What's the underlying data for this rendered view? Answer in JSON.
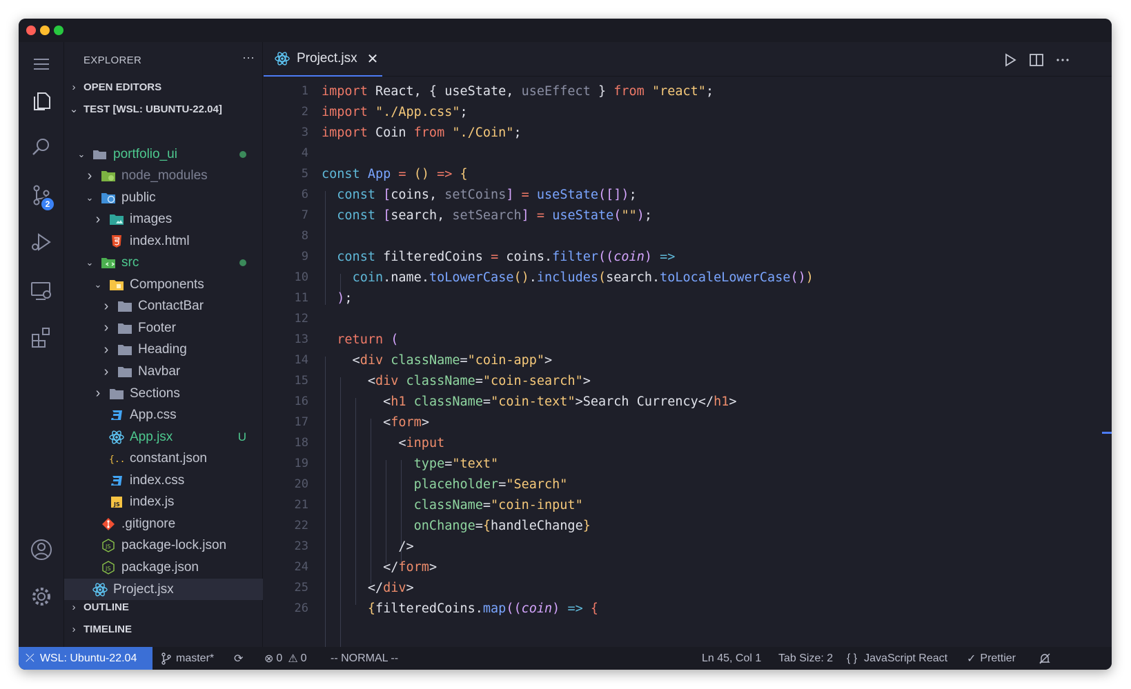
{
  "sidebar": {
    "title": "EXPLORER",
    "more": "···",
    "open_editors": "OPEN EDITORS",
    "workspace": "TEST [WSL: UBUNTU-22.04]",
    "outline": "OUTLINE",
    "timeline": "TIMELINE",
    "tree": [
      {
        "label": "portfolio_ui",
        "icon": "folder-open-icon",
        "dot": true,
        "color": "#4ec98f"
      },
      {
        "label": "node_modules",
        "icon": "node-folder-icon",
        "color": "#7c8093"
      },
      {
        "label": "public",
        "icon": "public-folder-icon"
      },
      {
        "label": "images",
        "icon": "images-folder-icon"
      },
      {
        "label": "index.html",
        "icon": "html-icon"
      },
      {
        "label": "src",
        "icon": "src-folder-icon",
        "dot": true,
        "color": "#4ec98f"
      },
      {
        "label": "Components",
        "icon": "components-folder-icon"
      },
      {
        "label": "ContactBar",
        "icon": "folder-icon"
      },
      {
        "label": "Footer",
        "icon": "folder-icon"
      },
      {
        "label": "Heading",
        "icon": "folder-icon"
      },
      {
        "label": "Navbar",
        "icon": "folder-icon"
      },
      {
        "label": "Sections",
        "icon": "folder-icon"
      },
      {
        "label": "App.css",
        "icon": "css-icon"
      },
      {
        "label": "App.jsx",
        "icon": "react-icon",
        "badge": "U",
        "color": "#4ec98f"
      },
      {
        "label": "constant.json",
        "icon": "json-icon"
      },
      {
        "label": "index.css",
        "icon": "css-icon"
      },
      {
        "label": "index.js",
        "icon": "js-icon"
      },
      {
        "label": ".gitignore",
        "icon": "git-icon"
      },
      {
        "label": "package-lock.json",
        "icon": "npm-icon"
      },
      {
        "label": "package.json",
        "icon": "npm-icon"
      },
      {
        "label": "Project.jsx",
        "icon": "react-icon",
        "active": true
      }
    ]
  },
  "activity": {
    "source_control_badge": "2"
  },
  "tab": {
    "label": "Project.jsx",
    "close": "✕"
  },
  "editor": {
    "line_numbers": [
      "1",
      "2",
      "3",
      "4",
      "5",
      "6",
      "7",
      "8",
      "9",
      "10",
      "11",
      "12",
      "13",
      "14",
      "15",
      "16",
      "17",
      "18",
      "19",
      "20",
      "21",
      "22",
      "23",
      "24",
      "25",
      "26"
    ]
  },
  "status": {
    "remote": "WSL: Ubuntu-22.04",
    "branch": "master*",
    "errors": "0",
    "warnings": "0",
    "mode": "-- NORMAL --",
    "position": "Ln 45, Col 1",
    "tab_size": "Tab Size: 2",
    "language": "JavaScript React",
    "formatter": "Prettier"
  },
  "colors": {
    "accent": "#3b6fd6",
    "background": "#1e1f29"
  }
}
